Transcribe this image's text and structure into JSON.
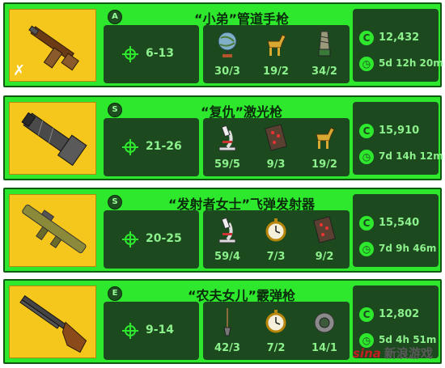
{
  "weapons": [
    {
      "rarity": "A",
      "name": "“小弟”管道手枪",
      "damage": "6-13",
      "materials": [
        {
          "icon": "globe-icon",
          "count": "30/3"
        },
        {
          "icon": "horse-toy-icon",
          "count": "19/2"
        },
        {
          "icon": "drill-bit-icon",
          "count": "34/2"
        }
      ],
      "caps": "12,432",
      "time": "5d 12h 20m"
    },
    {
      "rarity": "S",
      "name": "“复仇”激光枪",
      "damage": "21-26",
      "materials": [
        {
          "icon": "microscope-icon",
          "count": "59/5"
        },
        {
          "icon": "circuit-board-icon",
          "count": "9/3"
        },
        {
          "icon": "horse-toy-icon",
          "count": "19/2"
        }
      ],
      "caps": "15,910",
      "time": "7d 14h 12m"
    },
    {
      "rarity": "S",
      "name": "“发射者女士”飞弹发射器",
      "damage": "20-25",
      "materials": [
        {
          "icon": "microscope-icon",
          "count": "59/4"
        },
        {
          "icon": "pocket-watch-icon",
          "count": "7/3"
        },
        {
          "icon": "circuit-board-icon",
          "count": "9/2"
        }
      ],
      "caps": "15,540",
      "time": "7d 9h 46m"
    },
    {
      "rarity": "E",
      "name": "“农夫女儿”霰弹枪",
      "damage": "9-14",
      "materials": [
        {
          "icon": "shovel-icon",
          "count": "42/3"
        },
        {
          "icon": "pocket-watch-icon",
          "count": "7/2"
        },
        {
          "icon": "duct-tape-icon",
          "count": "14/1"
        }
      ],
      "caps": "12,802",
      "time": "5d 4h 51m"
    }
  ],
  "watermark": {
    "brand": "sina",
    "text": "新浪游戏"
  },
  "colors": {
    "card": "#2ee82e",
    "panel": "#1c4a1e",
    "text": "#8cf08c",
    "weapon_bg": "#f5c61b"
  }
}
